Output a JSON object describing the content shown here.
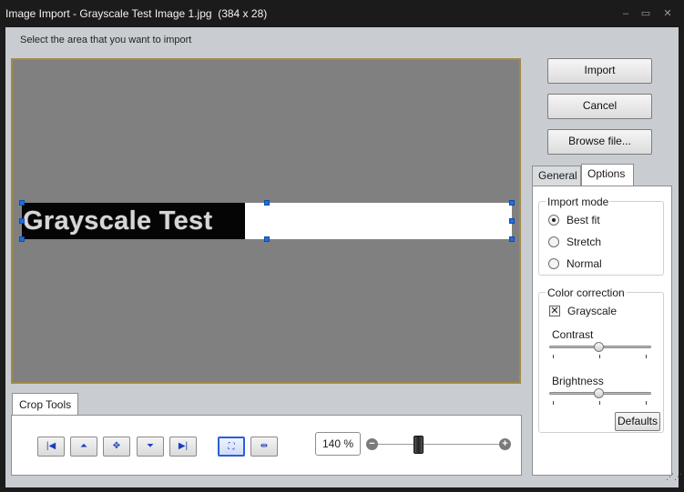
{
  "window": {
    "title": "Image Import - Grayscale Test Image 1.jpg  (384 x 28)",
    "minimize": "‒",
    "maximize": "▭",
    "close": "✕"
  },
  "hint": "Select the area that you want to import",
  "preview": {
    "image_text": "Grayscale Test"
  },
  "actions": {
    "import_label": "Import",
    "cancel_label": "Cancel",
    "browse_label": "Browse file..."
  },
  "tabs": {
    "general": "General",
    "options": "Options"
  },
  "import_mode": {
    "title": "Import mode",
    "options": [
      "Best fit",
      "Stretch",
      "Normal"
    ],
    "selected": "Best fit"
  },
  "color_correction": {
    "title": "Color correction",
    "grayscale_label": "Grayscale",
    "grayscale_checked": true,
    "contrast_label": "Contrast",
    "contrast_value": 0.5,
    "brightness_label": "Brightness",
    "brightness_value": 0.5,
    "defaults_label": "Defaults"
  },
  "crop_tools": {
    "tab_label": "Crop Tools",
    "zoom": "140 %",
    "zoom_out": "−",
    "zoom_in": "+"
  },
  "icons": {
    "first": "first-icon",
    "top": "align-top-icon",
    "center": "center-icon",
    "bottom": "align-bottom-icon",
    "last": "last-icon",
    "fit": "fit-selection-icon",
    "fit_width": "fit-width-icon"
  },
  "colors": {
    "canvas_bg": "#808080",
    "canvas_border": "#a38a4a",
    "handle": "#1f6fe0",
    "titlebar": "#1b1b1b"
  }
}
